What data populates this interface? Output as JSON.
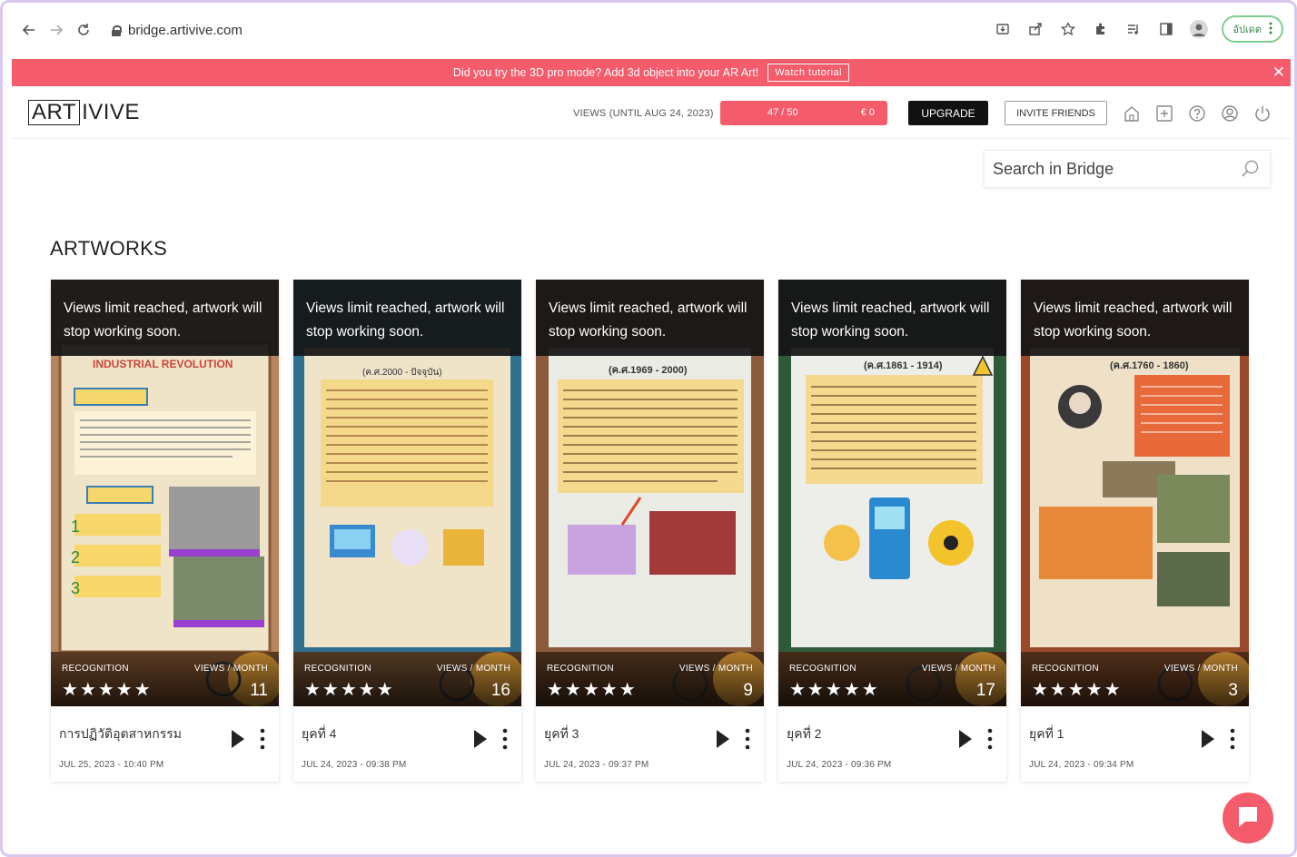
{
  "browser": {
    "url": "bridge.artivive.com",
    "profile_label": "อัปเดต"
  },
  "banner": {
    "message": "Did you try the 3D pro mode? Add 3d object into your AR Art!",
    "button": "Watch tutorial",
    "close": "✕"
  },
  "header": {
    "logo_boxed": "ART",
    "logo_rest": "IVIVE",
    "views_label": "VIEWS (UNTIL AUG 24, 2023)",
    "views_used": 47,
    "views_limit": 50,
    "views_count": "47 / 50",
    "views_price": "€ 0",
    "upgrade": "UPGRADE",
    "invite": "INVITE FRIENDS"
  },
  "search": {
    "placeholder": "Search in Bridge"
  },
  "section_title": "ARTWORKS",
  "card_labels": {
    "overlay": "Views limit reached, artwork will stop working soon.",
    "recognition": "RECOGNITION",
    "views_month": "VIEWS / MONTH",
    "stars": "★★★★★"
  },
  "artworks": [
    {
      "title": "การปฏิวัติอุตสาหกรรม",
      "date": "JUL 25, 2023 - 10:40 PM",
      "views_month": "11",
      "rating": 5,
      "poster_header": "INDUSTRIAL REVOLUTION",
      "accent": "#c9463a"
    },
    {
      "title": "ยุคที่ 4",
      "date": "JUL 24, 2023 - 09:38 PM",
      "views_month": "16",
      "rating": 5,
      "poster_header": "(ค.ศ.2000 - ปัจจุบัน)",
      "accent": "#2f6f8f"
    },
    {
      "title": "ยุคที่ 3",
      "date": "JUL 24, 2023 - 09:37 PM",
      "views_month": "9",
      "rating": 5,
      "poster_header": "(ค.ศ.1969 - 2000)",
      "accent": "#8a5a3a"
    },
    {
      "title": "ยุคที่ 2",
      "date": "JUL 24, 2023 - 09:36 PM",
      "views_month": "17",
      "rating": 5,
      "poster_header": "(ค.ศ.1861 - 1914)",
      "accent": "#2f5a3a"
    },
    {
      "title": "ยุคที่ 1",
      "date": "JUL 24, 2023 - 09:34 PM",
      "views_month": "3",
      "rating": 5,
      "poster_header": "(ค.ศ.1760 - 1860)",
      "accent": "#9a4a2a"
    }
  ]
}
